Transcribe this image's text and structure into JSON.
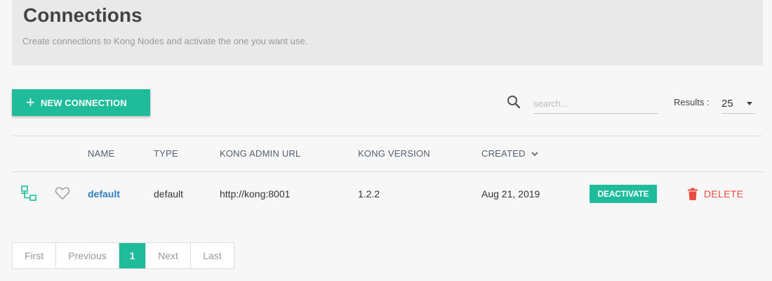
{
  "header": {
    "title": "Connections",
    "subtitle": "Create connections to Kong Nodes and activate the one you want use."
  },
  "toolbar": {
    "new_connection_label": "NEW CONNECTION",
    "search_placeholder": "search...",
    "results_label": "Results :",
    "results_value": "25"
  },
  "table": {
    "columns": [
      "NAME",
      "TYPE",
      "KONG ADMIN URL",
      "KONG VERSION",
      "CREATED"
    ],
    "sort_column": "CREATED",
    "rows": [
      {
        "name": "default",
        "type": "default",
        "kong_admin_url": "http://kong:8001",
        "kong_version": "1.2.2",
        "created": "Aug 21, 2019",
        "action_label": "DEACTIVATE",
        "delete_label": "DELETE",
        "status_icon": "connection-active-icon",
        "favorite_icon": "heart-outline-icon"
      }
    ]
  },
  "pagination": {
    "first": "First",
    "previous": "Previous",
    "current": "1",
    "next": "Next",
    "last": "Last"
  },
  "colors": {
    "accent": "#1fbc9c",
    "danger": "#e84c3d",
    "link": "#2d7fbf"
  }
}
